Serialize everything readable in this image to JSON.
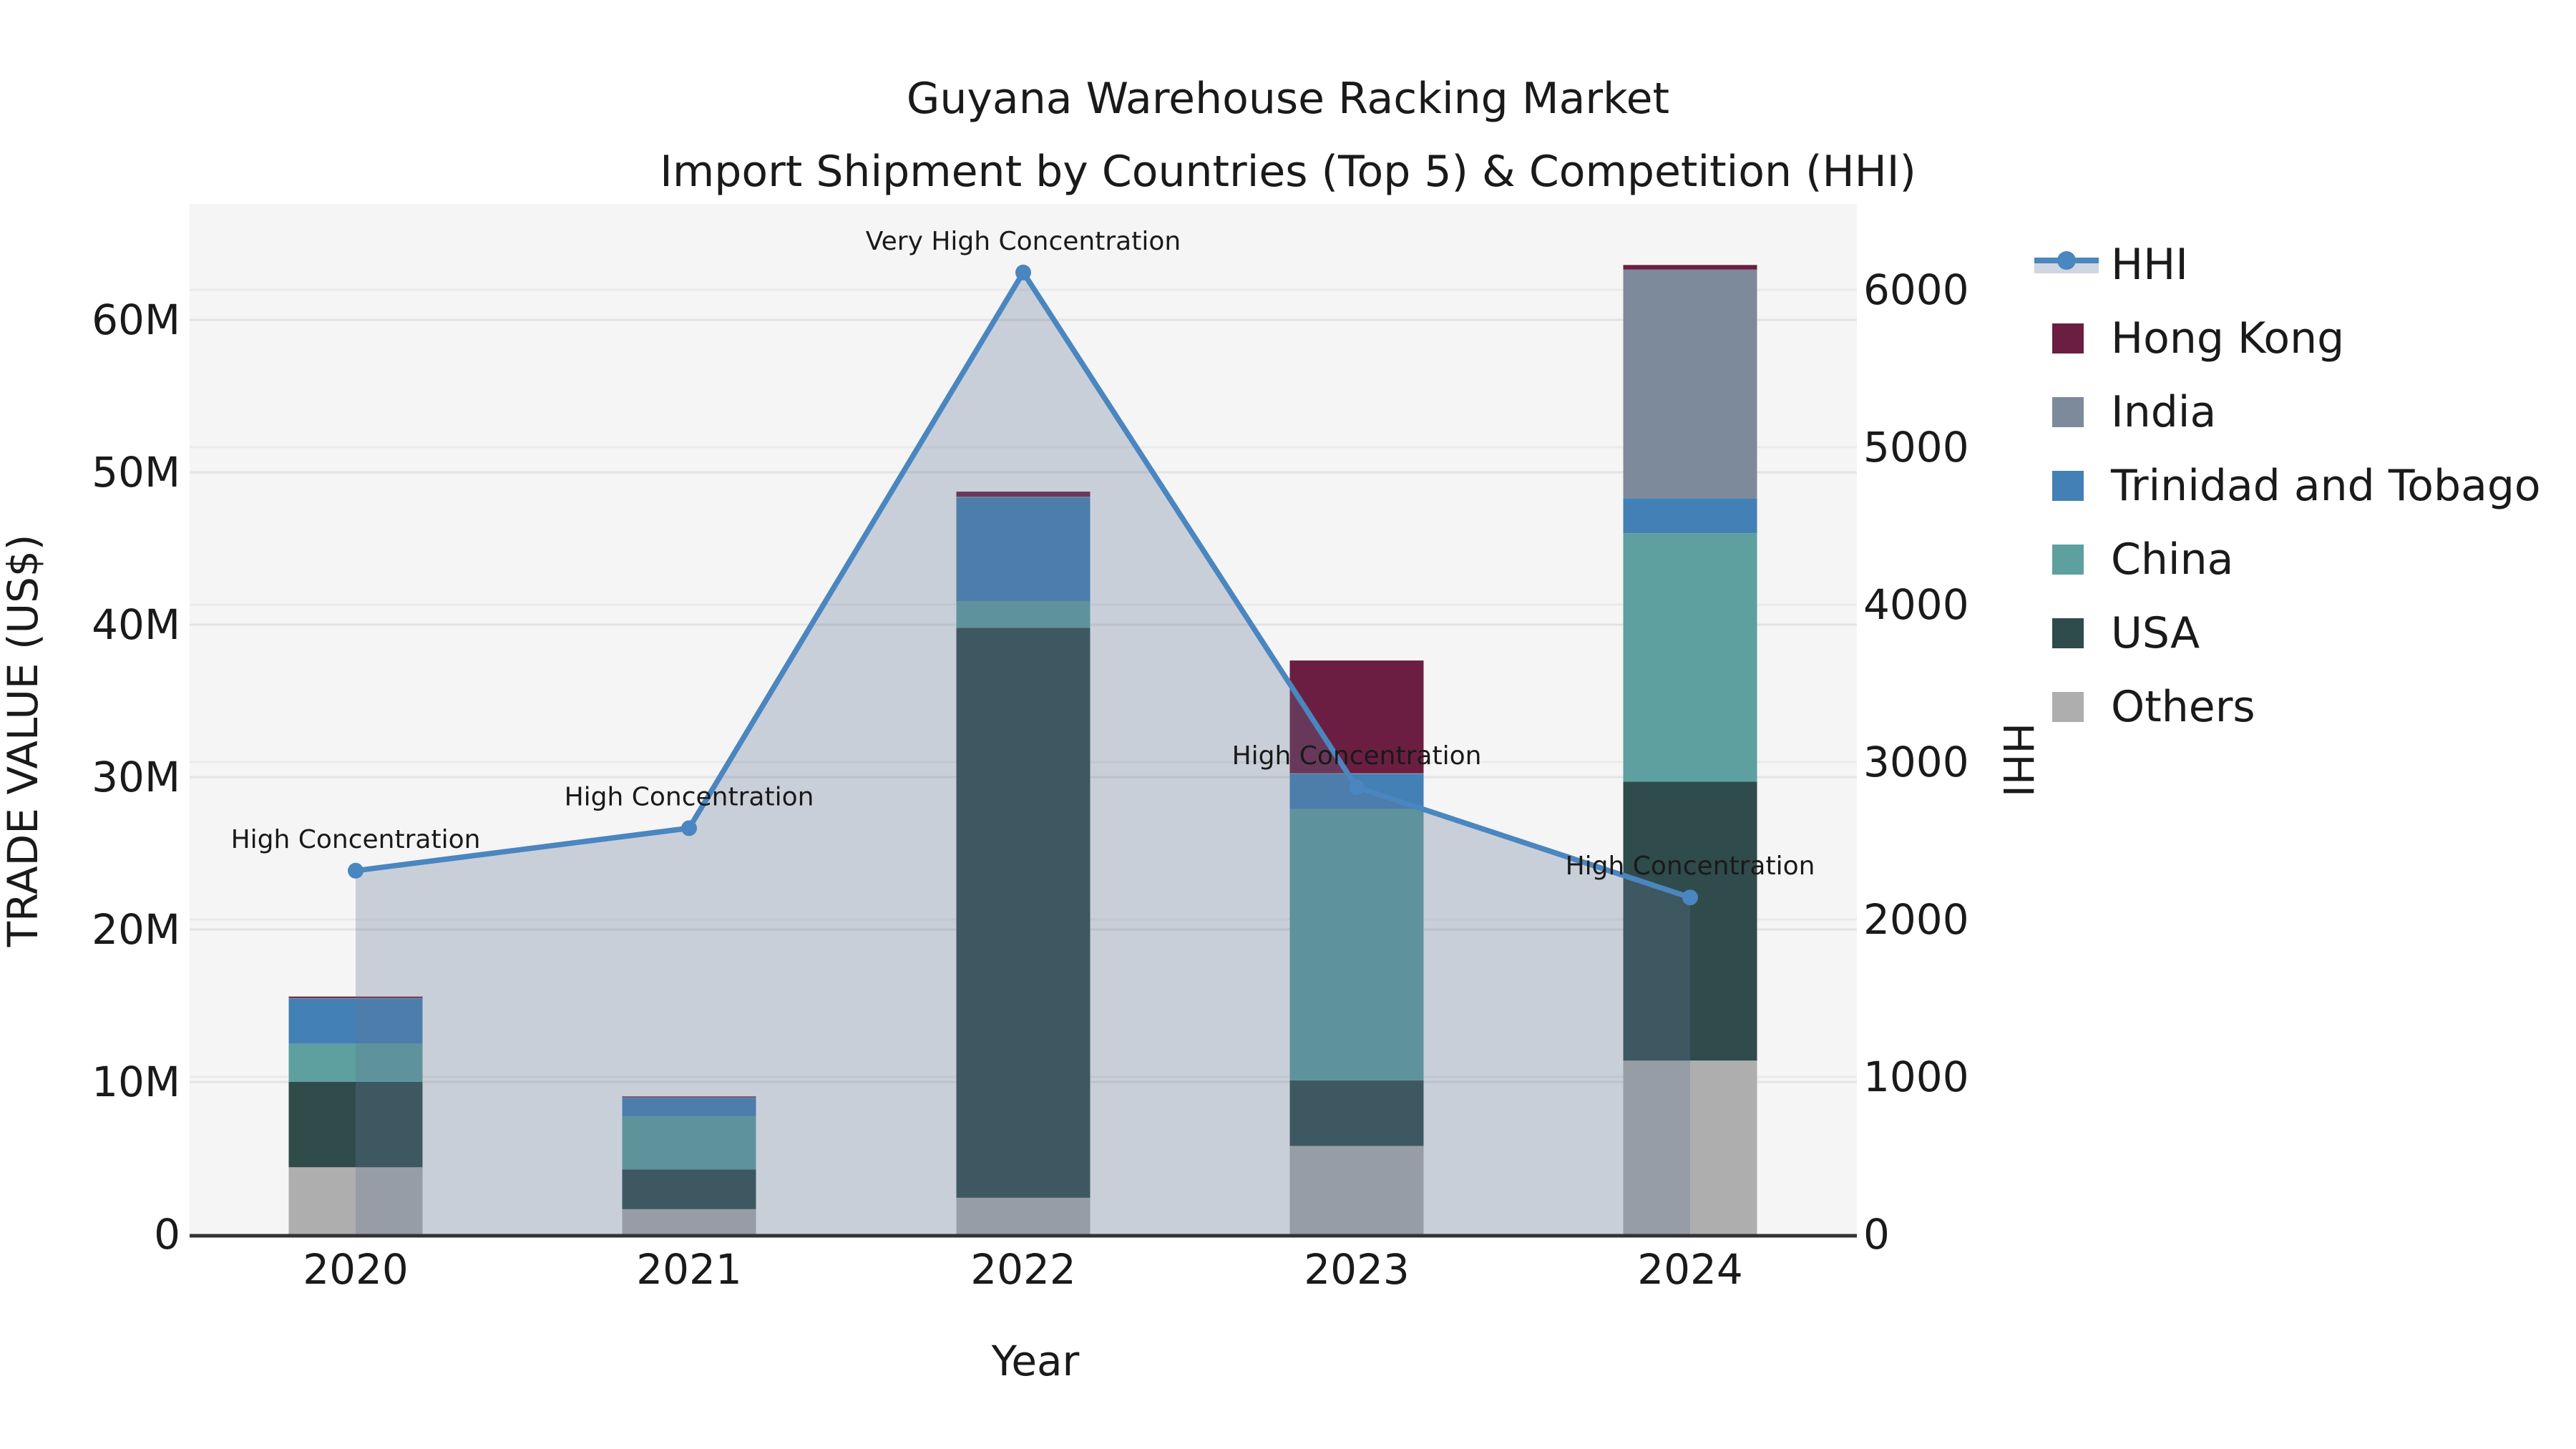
{
  "title": {
    "line1": "Guyana Warehouse Racking Market",
    "line2": "Import Shipment by Countries (Top 5) & Competition (HHI)"
  },
  "axes": {
    "x": {
      "label": "Year",
      "ticks": [
        "2020",
        "2021",
        "2022",
        "2023",
        "2024"
      ]
    },
    "y_left": {
      "label": "TRADE VALUE (US$)",
      "ticks": [
        "0",
        "10M",
        "20M",
        "30M",
        "40M",
        "50M",
        "60M"
      ],
      "range_musd": [
        0,
        67.5
      ]
    },
    "y_right": {
      "label": "HHI",
      "ticks": [
        "0",
        "1000",
        "2000",
        "3000",
        "4000",
        "5000",
        "6000"
      ],
      "range": [
        0,
        6540
      ]
    }
  },
  "legend": {
    "position": "right",
    "items": [
      {
        "label": "HHI",
        "type": "line-area",
        "color": "#4a86bf",
        "band_color": "#d0d6df"
      },
      {
        "label": "Hong Kong",
        "type": "swatch",
        "color": "#6b1e41"
      },
      {
        "label": "India",
        "type": "swatch",
        "color": "#7d8a9c"
      },
      {
        "label": "Trinidad and Tobago",
        "type": "swatch",
        "color": "#4380b5"
      },
      {
        "label": "China",
        "type": "swatch",
        "color": "#5da09f"
      },
      {
        "label": "USA",
        "type": "swatch",
        "color": "#2f4b4c"
      },
      {
        "label": "Others",
        "type": "swatch",
        "color": "#aeaeae"
      }
    ]
  },
  "chart_data": {
    "type": "bar",
    "subtype": "stacked-bars-with-line-overlay",
    "categories": [
      "2020",
      "2021",
      "2022",
      "2023",
      "2024"
    ],
    "bar_value_unit": "million US$",
    "stack_order": "bottom_to_top",
    "series": [
      {
        "name": "Others",
        "color": "#aeaeae",
        "values": [
          4.4,
          1.65,
          2.4,
          5.8,
          11.4
        ]
      },
      {
        "name": "USA",
        "color": "#2f4b4c",
        "values": [
          5.6,
          2.6,
          37.4,
          4.3,
          18.3
        ]
      },
      {
        "name": "China",
        "color": "#5da09f",
        "values": [
          2.5,
          3.5,
          1.75,
          17.8,
          16.3
        ]
      },
      {
        "name": "Trinidad and Tobago",
        "color": "#4380b5",
        "values": [
          2.95,
          1.2,
          6.8,
          2.3,
          2.3
        ]
      },
      {
        "name": "India",
        "color": "#7d8a9c",
        "values": [
          0.05,
          0.03,
          0.05,
          0.05,
          15.0
        ]
      },
      {
        "name": "Hong Kong",
        "color": "#6b1e41",
        "values": [
          0.1,
          0.07,
          0.33,
          7.4,
          0.3
        ]
      }
    ],
    "bar_totals_musd": [
      15.6,
      9.05,
      48.73,
      37.65,
      63.6
    ],
    "line_series": {
      "name": "HHI",
      "axis": "right",
      "color": "#4a86bf",
      "marker": "circle",
      "area_fill": "rgba(100,120,150,0.30)",
      "values": [
        2310,
        2580,
        6110,
        2840,
        2140
      ]
    },
    "annotations": [
      {
        "x": "2020",
        "text": "High Concentration"
      },
      {
        "x": "2021",
        "text": "High Concentration"
      },
      {
        "x": "2022",
        "text": "Very High Concentration"
      },
      {
        "x": "2023",
        "text": "High Concentration"
      },
      {
        "x": "2024",
        "text": "High Concentration"
      }
    ],
    "title": "Guyana Warehouse Racking Market Import Shipment by Countries (Top 5) & Competition (HHI)",
    "xlabel": "Year",
    "ylabel": "TRADE VALUE (US$)",
    "y2label": "HHI",
    "grid": true,
    "plot_background": "#f5f5f6",
    "gridline_color": "#e5e5e5",
    "bottom_spine_color": "#333333",
    "legend_position": "upper right outside"
  }
}
